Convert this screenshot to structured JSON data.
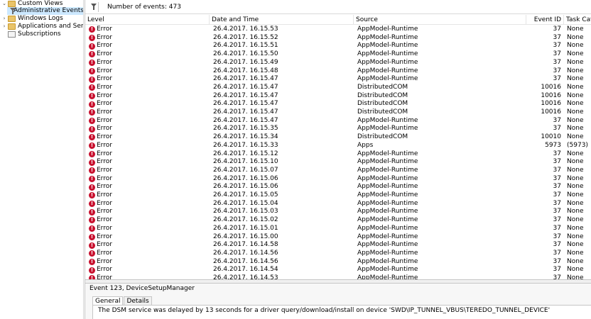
{
  "tree": {
    "items": [
      {
        "label": "Custom Views",
        "expander": "⌄",
        "icon": "folder-icon"
      },
      {
        "label": "Administrative Events",
        "expander": "",
        "icon": "filter-icon",
        "selected": true
      },
      {
        "label": "Windows Logs",
        "expander": "›",
        "icon": "folder-icon"
      },
      {
        "label": "Applications and Services Lo",
        "expander": "›",
        "icon": "folder-icon"
      },
      {
        "label": "Subscriptions",
        "expander": "",
        "icon": "document-icon"
      }
    ]
  },
  "filterbar": {
    "text": "Number of events: 473"
  },
  "table": {
    "columns": [
      "Level",
      "Date and Time",
      "Source",
      "Event ID",
      "Task Categ"
    ],
    "rows": [
      [
        "Error",
        "26.4.2017. 16.15.53",
        "AppModel-Runtime",
        "37",
        "None"
      ],
      [
        "Error",
        "26.4.2017. 16.15.52",
        "AppModel-Runtime",
        "37",
        "None"
      ],
      [
        "Error",
        "26.4.2017. 16.15.51",
        "AppModel-Runtime",
        "37",
        "None"
      ],
      [
        "Error",
        "26.4.2017. 16.15.50",
        "AppModel-Runtime",
        "37",
        "None"
      ],
      [
        "Error",
        "26.4.2017. 16.15.49",
        "AppModel-Runtime",
        "37",
        "None"
      ],
      [
        "Error",
        "26.4.2017. 16.15.48",
        "AppModel-Runtime",
        "37",
        "None"
      ],
      [
        "Error",
        "26.4.2017. 16.15.47",
        "AppModel-Runtime",
        "37",
        "None"
      ],
      [
        "Error",
        "26.4.2017. 16.15.47",
        "DistributedCOM",
        "10016",
        "None"
      ],
      [
        "Error",
        "26.4.2017. 16.15.47",
        "DistributedCOM",
        "10016",
        "None"
      ],
      [
        "Error",
        "26.4.2017. 16.15.47",
        "DistributedCOM",
        "10016",
        "None"
      ],
      [
        "Error",
        "26.4.2017. 16.15.47",
        "DistributedCOM",
        "10016",
        "None"
      ],
      [
        "Error",
        "26.4.2017. 16.15.47",
        "AppModel-Runtime",
        "37",
        "None"
      ],
      [
        "Error",
        "26.4.2017. 16.15.35",
        "AppModel-Runtime",
        "37",
        "None"
      ],
      [
        "Error",
        "26.4.2017. 16.15.34",
        "DistributedCOM",
        "10010",
        "None"
      ],
      [
        "Error",
        "26.4.2017. 16.15.33",
        "Apps",
        "5973",
        "(5973)"
      ],
      [
        "Error",
        "26.4.2017. 16.15.12",
        "AppModel-Runtime",
        "37",
        "None"
      ],
      [
        "Error",
        "26.4.2017. 16.15.10",
        "AppModel-Runtime",
        "37",
        "None"
      ],
      [
        "Error",
        "26.4.2017. 16.15.07",
        "AppModel-Runtime",
        "37",
        "None"
      ],
      [
        "Error",
        "26.4.2017. 16.15.06",
        "AppModel-Runtime",
        "37",
        "None"
      ],
      [
        "Error",
        "26.4.2017. 16.15.06",
        "AppModel-Runtime",
        "37",
        "None"
      ],
      [
        "Error",
        "26.4.2017. 16.15.05",
        "AppModel-Runtime",
        "37",
        "None"
      ],
      [
        "Error",
        "26.4.2017. 16.15.04",
        "AppModel-Runtime",
        "37",
        "None"
      ],
      [
        "Error",
        "26.4.2017. 16.15.03",
        "AppModel-Runtime",
        "37",
        "None"
      ],
      [
        "Error",
        "26.4.2017. 16.15.02",
        "AppModel-Runtime",
        "37",
        "None"
      ],
      [
        "Error",
        "26.4.2017. 16.15.01",
        "AppModel-Runtime",
        "37",
        "None"
      ],
      [
        "Error",
        "26.4.2017. 16.15.00",
        "AppModel-Runtime",
        "37",
        "None"
      ],
      [
        "Error",
        "26.4.2017. 16.14.58",
        "AppModel-Runtime",
        "37",
        "None"
      ],
      [
        "Error",
        "26.4.2017. 16.14.56",
        "AppModel-Runtime",
        "37",
        "None"
      ],
      [
        "Error",
        "26.4.2017. 16.14.56",
        "AppModel-Runtime",
        "37",
        "None"
      ],
      [
        "Error",
        "26.4.2017. 16.14.54",
        "AppModel-Runtime",
        "37",
        "None"
      ],
      [
        "Error",
        "26.4.2017. 16.14.53",
        "AppModel-Runtime",
        "37",
        "None"
      ]
    ]
  },
  "detail": {
    "title": "Event 123, DeviceSetupManager",
    "tabs": [
      "General",
      "Details"
    ],
    "active_tab": "General",
    "text": "The DSM service was delayed by 13 seconds for a driver query/download/install on device 'SWD\\IP_TUNNEL_VBUS\\TEREDO_TUNNEL_DEVICE'"
  },
  "colors": {
    "error": "#c8102e",
    "selection": "#cce8ff"
  }
}
